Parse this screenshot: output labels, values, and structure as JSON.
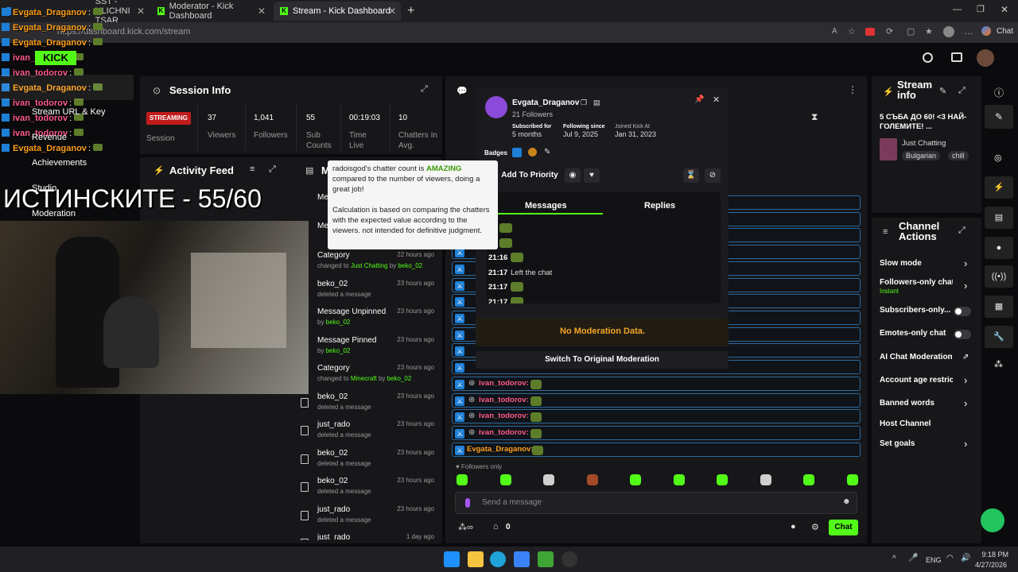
{
  "browser": {
    "tabs": [
      {
        "label": "SST - ULICHNI TSAR"
      },
      {
        "label": "Moderator - Kick Dashboard"
      },
      {
        "label": "Stream - Kick Dashboard"
      }
    ],
    "url": "https://dashboard.kick.com/stream"
  },
  "session": {
    "title": "Session Info",
    "status": "STREAMING",
    "session_label": "Session",
    "stats": [
      {
        "value": "37",
        "label": "Viewers"
      },
      {
        "value": "1,041",
        "label": "Followers"
      },
      {
        "value": "55",
        "label": "Sub Counts"
      },
      {
        "value": "00:19:03",
        "label": "Time Live"
      },
      {
        "value": "10",
        "label": "Chatters In Avg."
      }
    ]
  },
  "tooltip": {
    "line1_pre": "radoisgod's chatter count is ",
    "line1_em": "AMAZING",
    "line1_post": " compared to the number of viewers, doing a great job!",
    "line2": "Calculation is based on comparing the chatters with the expected value according to the viewers. not intended for definitive judgment."
  },
  "activity": {
    "title": "Activity Feed",
    "items": [
      {
        "title": "Category",
        "sub_pre": "changed to ",
        "sub_hl": "Just Chatting",
        "sub_by": " by ",
        "user": "beko_02",
        "time": "22 hours ago"
      },
      {
        "title": "beko_02",
        "sub": "deleted a message",
        "time": "23 hours ago"
      },
      {
        "title": "Message Unpinned",
        "sub_by": "by ",
        "user": "beko_02",
        "time": "23 hours ago"
      },
      {
        "title": "Message Pinned",
        "sub_by": "by ",
        "user": "beko_02",
        "time": "23 hours ago"
      },
      {
        "title": "Category",
        "sub_pre": "changed to ",
        "sub_hl": "Minecraft",
        "sub_by": " by ",
        "user": "beko_02",
        "time": "23 hours ago"
      },
      {
        "title": "beko_02",
        "sub": "deleted a message",
        "time": "23 hours ago"
      },
      {
        "title": "just_rado",
        "sub": "deleted a message",
        "time": "23 hours ago"
      },
      {
        "title": "beko_02",
        "sub": "deleted a message",
        "time": "23 hours ago"
      },
      {
        "title": "beko_02",
        "sub": "deleted a message",
        "time": "23 hours ago"
      },
      {
        "title": "just_rado",
        "sub": "deleted a message",
        "time": "23 hours ago"
      },
      {
        "title": "just_rado",
        "sub": "",
        "time": "1 day ago"
      }
    ],
    "partial_top": [
      "Me",
      "Me"
    ]
  },
  "usercard": {
    "name": "Evgata_Draganov",
    "followers": "21 Followers",
    "subscribed_label": "Subscribed for",
    "subscribed_value": "5 months",
    "following_label": "Following since",
    "following_value": "Jul 9, 2025",
    "joined_label": "Joined Kick At",
    "joined_value": "Jan 31, 2023",
    "badges_label": "Badges",
    "add_priority": "Add To Priority",
    "tab_messages": "Messages",
    "tab_replies": "Replies",
    "messages": [
      {
        "time": "16",
        "text": ""
      },
      {
        "time": "16",
        "text": ""
      },
      {
        "time": "21:16",
        "text": ""
      },
      {
        "time": "21:17",
        "text": "Left the chat"
      },
      {
        "time": "21:17",
        "text": ""
      },
      {
        "time": "21:17",
        "text": ""
      }
    ],
    "no_mod": "No Moderation Data.",
    "switch": "Switch To Original Moderation"
  },
  "chat": {
    "rows": [
      {
        "user": "ivan_todorov",
        "color": "#ff5a8a"
      },
      {
        "user": "ivan_todorov",
        "color": "#ff5a8a"
      },
      {
        "user": "ivan_todorov",
        "color": "#ff5a8a"
      },
      {
        "user": "ivan_todorov",
        "color": "#ff5a8a"
      },
      {
        "user": "Evgata_Draganov",
        "color": "#ff9f1a"
      }
    ],
    "followers_only": "Followers only",
    "placeholder": "Send a message",
    "count": "0",
    "chat_button": "Chat"
  },
  "stream_info": {
    "title": "Stream info",
    "stream_title": "5 СЪБА ДО 60! <3 НАЙ-ГОЛЕМИТЕ! ...",
    "category": "Just Chatting",
    "tags": [
      "Bulgarian",
      "chill"
    ]
  },
  "channel_actions": {
    "title": "Channel Actions",
    "items": [
      {
        "label": "Slow mode",
        "control": "chevron"
      },
      {
        "label": "Followers-only chat",
        "sub": "Instant",
        "control": "chevron"
      },
      {
        "label": "Subscribers-only...",
        "control": "toggle"
      },
      {
        "label": "Emotes-only chat",
        "control": "toggle"
      },
      {
        "label": "AI Chat Moderation",
        "control": "external"
      },
      {
        "label": "Account age restrictio",
        "control": "chevron"
      },
      {
        "label": "Banned words",
        "control": "chevron"
      },
      {
        "label": "Host Channel",
        "control": "none"
      },
      {
        "label": "Set goals",
        "control": "chevron"
      }
    ]
  },
  "overlay": {
    "chat_lines": [
      {
        "name": "Evgata_Draganov",
        "color": "#ff9f1a"
      },
      {
        "name": "Evgata_Draganov",
        "color": "#ff9f1a"
      },
      {
        "name": "Evgata_Draganov",
        "color": "#ff9f1a"
      },
      {
        "name": "ivan_todorov",
        "color": "#ff5a8a"
      },
      {
        "name": "ivan_todorov",
        "color": "#ff5a8a"
      },
      {
        "name": "Evgata_Draganov",
        "color": "#ff9f1a"
      },
      {
        "name": "ivan_todorov",
        "color": "#ff5a8a"
      },
      {
        "name": "ivan_todorov",
        "color": "#ff5a8a"
      },
      {
        "name": "ivan_todorov",
        "color": "#ff5a8a"
      },
      {
        "name": "Evgata_Draganov",
        "color": "#ff9f1a"
      }
    ],
    "sidebar_labels": [
      "Stream URL & Key",
      "Revenue",
      "Achievements",
      "Studio",
      "Moderation"
    ],
    "big_text": "ИСТИНСКИТЕ - 55/60"
  },
  "taskbar": {
    "lang": "ENG",
    "time": "9:18 PM",
    "date": "4/27/2026"
  },
  "colors": {
    "accent": "#53fc18",
    "panel": "#17171a",
    "bg": "#0b0b0d"
  }
}
